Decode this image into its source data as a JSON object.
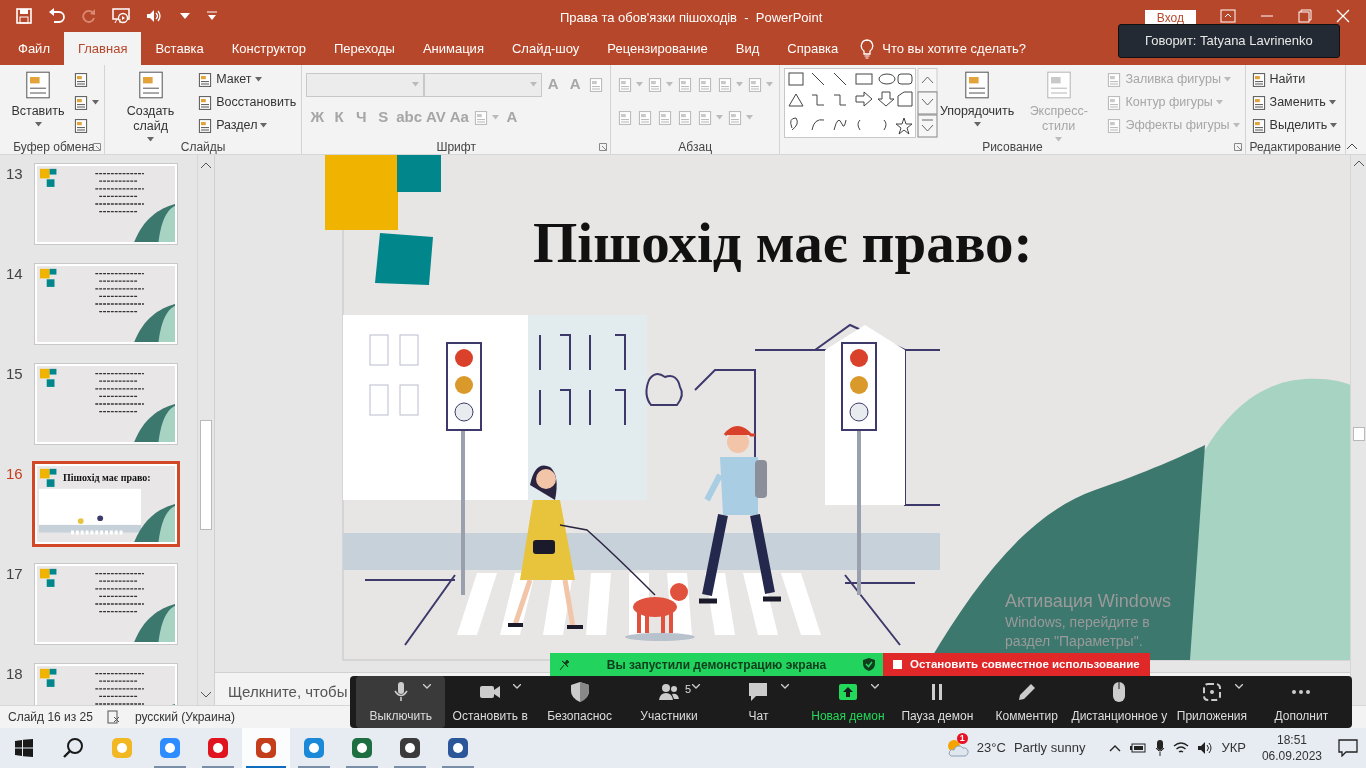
{
  "window": {
    "title": "Права та обов'язки пішоходів  -  PowerPoint",
    "sign_in": "Вход"
  },
  "speaker_tooltip": "Говорит: Tatyana Lavrinenko",
  "tabs": [
    {
      "label": "Файл",
      "selected": false
    },
    {
      "label": "Главная",
      "selected": true
    },
    {
      "label": "Вставка",
      "selected": false
    },
    {
      "label": "Конструктор",
      "selected": false
    },
    {
      "label": "Переходы",
      "selected": false
    },
    {
      "label": "Анимация",
      "selected": false
    },
    {
      "label": "Слайд-шоу",
      "selected": false
    },
    {
      "label": "Рецензирование",
      "selected": false
    },
    {
      "label": "Вид",
      "selected": false
    },
    {
      "label": "Справка",
      "selected": false
    }
  ],
  "tell_me": "Что вы хотите сделать?",
  "ribbon": [
    {
      "label": "Буфер обмена",
      "launcher": true,
      "items": [
        {
          "kind": "large",
          "label": "Вставить",
          "dropdown": true,
          "disabled": false
        },
        {
          "kind": "icon",
          "dropdown": false,
          "disabled": false
        },
        {
          "kind": "icon",
          "dropdown": true,
          "disabled": false
        },
        {
          "kind": "icon",
          "dropdown": false,
          "disabled": false
        }
      ]
    },
    {
      "label": "Слайды",
      "launcher": false,
      "items": [
        {
          "kind": "large",
          "label": "Создать слайд",
          "dropdown": true,
          "disabled": false
        },
        {
          "kind": "small",
          "label": "Макет",
          "dropdown": true,
          "disabled": false
        },
        {
          "kind": "small",
          "label": "Восстановить",
          "dropdown": false,
          "disabled": false
        },
        {
          "kind": "small",
          "label": "Раздел",
          "dropdown": true,
          "disabled": false
        }
      ]
    },
    {
      "label": "Шрифт",
      "launcher": true,
      "rows": [
        [
          {
            "kind": "field",
            "disabled": true
          },
          {
            "kind": "field",
            "disabled": true
          },
          {
            "kind": "glyph",
            "label": "A",
            "disabled": true
          },
          {
            "kind": "glyph",
            "label": "A",
            "disabled": true
          },
          {
            "kind": "icon",
            "dropdown": false,
            "disabled": true
          }
        ],
        [
          {
            "kind": "glyph",
            "label": "Ж",
            "disabled": true
          },
          {
            "kind": "glyph",
            "label": "К",
            "disabled": true
          },
          {
            "kind": "glyph",
            "label": "Ч",
            "disabled": true
          },
          {
            "kind": "glyph",
            "label": "S",
            "disabled": true
          },
          {
            "kind": "glyph",
            "label": "abc",
            "disabled": true
          },
          {
            "kind": "glyph",
            "label": "AV",
            "disabled": true
          },
          {
            "kind": "glyph",
            "label": "Aa",
            "disabled": true
          },
          {
            "kind": "icon",
            "dropdown": true,
            "disabled": true
          },
          {
            "kind": "glyph",
            "label": "A",
            "disabled": true
          }
        ]
      ]
    },
    {
      "label": "Абзац",
      "launcher": false,
      "rows": [
        [
          {
            "kind": "icon",
            "dropdown": true,
            "disabled": true
          },
          {
            "kind": "icon",
            "dropdown": true,
            "disabled": true
          },
          {
            "kind": "icon",
            "dropdown": false,
            "disabled": true
          },
          {
            "kind": "icon",
            "dropdown": false,
            "disabled": true
          },
          {
            "kind": "icon",
            "dropdown": true,
            "disabled": true
          },
          {
            "kind": "icon",
            "dropdown": true,
            "disabled": true
          }
        ],
        [
          {
            "kind": "icon",
            "dropdown": false,
            "disabled": true
          },
          {
            "kind": "icon",
            "dropdown": false,
            "disabled": true
          },
          {
            "kind": "icon",
            "dropdown": false,
            "disabled": true
          },
          {
            "kind": "icon",
            "dropdown": false,
            "disabled": true
          },
          {
            "kind": "icon",
            "dropdown": true,
            "disabled": true
          },
          {
            "kind": "icon",
            "dropdown": true,
            "disabled": true
          }
        ]
      ]
    },
    {
      "label": "Рисование",
      "launcher": true,
      "items": [
        {
          "kind": "gallery"
        },
        {
          "kind": "large",
          "label": "Упорядочить",
          "dropdown": true,
          "disabled": false
        },
        {
          "kind": "large",
          "label": "Экспресс-стили",
          "dropdown": true,
          "disabled": true
        },
        {
          "kind": "small",
          "label": "Заливка фигуры",
          "dropdown": true,
          "disabled": true
        },
        {
          "kind": "small",
          "label": "Контур фигуры",
          "dropdown": true,
          "disabled": true
        },
        {
          "kind": "small",
          "label": "Эффекты фигуры",
          "dropdown": true,
          "disabled": true
        }
      ]
    },
    {
      "label": "Редактирование",
      "launcher": false,
      "items": [
        {
          "kind": "small",
          "label": "Найти",
          "dropdown": false,
          "disabled": false
        },
        {
          "kind": "small",
          "label": "Заменить",
          "dropdown": true,
          "disabled": false
        },
        {
          "kind": "small",
          "label": "Выделить",
          "dropdown": true,
          "disabled": false
        }
      ]
    }
  ],
  "thumbnails": [
    {
      "number": "13",
      "selected": false
    },
    {
      "number": "14",
      "selected": false
    },
    {
      "number": "15",
      "selected": false
    },
    {
      "number": "16",
      "selected": true,
      "title": "Пішохід має право:"
    },
    {
      "number": "17",
      "selected": false
    },
    {
      "number": "18",
      "selected": false
    }
  ],
  "slide": {
    "title": "Пішохід має право:"
  },
  "notes_hint": "Щелкните, чтобы",
  "status_bar": {
    "slide_counter": "Слайд 16 из 25",
    "language": "русский (Украина)"
  },
  "share_bar": {
    "message": "Вы запустили демонстрацию экрана",
    "stop": "Остановить совместное использование"
  },
  "meeting_toolbar": [
    {
      "kind": "microphone",
      "label": "Выключить",
      "hovered": true,
      "highlighted": false,
      "dropdown": true
    },
    {
      "kind": "camera",
      "label": "Остановить в",
      "hovered": false,
      "highlighted": false,
      "dropdown": true
    },
    {
      "kind": "shield",
      "label": "Безопаснос",
      "hovered": false,
      "highlighted": false,
      "dropdown": false
    },
    {
      "kind": "people",
      "label": "Участники",
      "count": "5",
      "hovered": false,
      "highlighted": false,
      "dropdown": true
    },
    {
      "kind": "chat",
      "label": "Чат",
      "hovered": false,
      "highlighted": false,
      "dropdown": true
    },
    {
      "kind": "share",
      "label": "Новая демон",
      "hovered": false,
      "highlighted": true,
      "dropdown": true
    },
    {
      "kind": "pause",
      "label": "Пауза демон",
      "hovered": false,
      "highlighted": false,
      "dropdown": false
    },
    {
      "kind": "pencil",
      "label": "Комментир",
      "hovered": false,
      "highlighted": false,
      "dropdown": false
    },
    {
      "kind": "mouse",
      "label": "Дистанционное у",
      "hovered": false,
      "highlighted": false,
      "dropdown": false
    },
    {
      "kind": "apps",
      "label": "Приложения",
      "hovered": false,
      "highlighted": false,
      "dropdown": true
    },
    {
      "kind": "more",
      "label": "Дополнит",
      "hovered": false,
      "highlighted": false,
      "dropdown": false
    }
  ],
  "activation_notice": [
    "Активация Windows",
    "Windows, перейдите в",
    "раздел \"Параметры\"."
  ],
  "taskbar": {
    "apps": [
      {
        "color": "#f2b824",
        "selected": false,
        "running": false
      },
      {
        "color": "#2d8cff",
        "selected": false,
        "running": true
      },
      {
        "color": "#e0141e",
        "selected": false,
        "running": true
      },
      {
        "color": "#c43e1c",
        "selected": true,
        "running": true
      },
      {
        "color": "#1a8ad8",
        "selected": false,
        "running": true
      },
      {
        "color": "#1d6f42",
        "selected": false,
        "running": true
      },
      {
        "color": "#3b3b3b",
        "selected": false,
        "running": true
      },
      {
        "color": "#2b579a",
        "selected": false,
        "running": true
      }
    ],
    "weather": {
      "badge": "1",
      "temperature": "23°C",
      "condition": "Partly sunny"
    },
    "language": "УКР",
    "time": "18:51",
    "date": "06.09.2023"
  }
}
